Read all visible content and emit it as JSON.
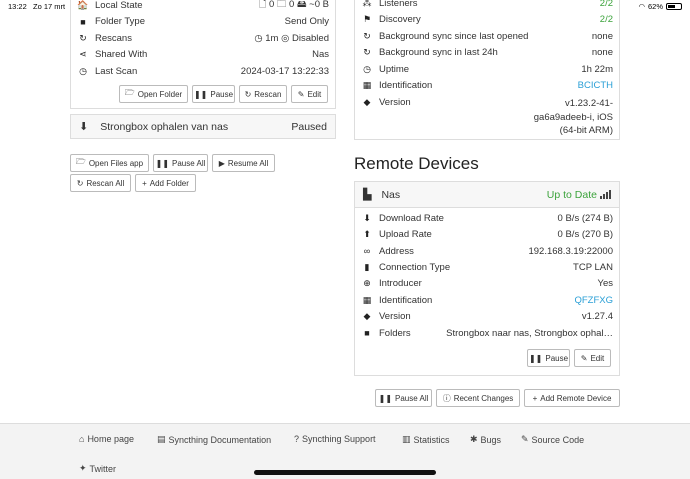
{
  "statusbar": {
    "time": "13:22",
    "date": "Zo 17 mrt",
    "battery": "62%",
    "battery_level": 0.62
  },
  "folder": {
    "rows": [
      {
        "icon": "globe-icon",
        "glyph": "🏠",
        "label": "Local State",
        "value": "🗋 0   🗀 0   🖴 ~0 B"
      },
      {
        "icon": "folder-icon",
        "glyph": "■",
        "label": "Folder Type",
        "value": "Send Only"
      },
      {
        "icon": "refresh-icon",
        "glyph": "↻",
        "label": "Rescans",
        "value": "◷ 1m   ◎ Disabled"
      },
      {
        "icon": "share-icon",
        "glyph": "⋖",
        "label": "Shared With",
        "value": "Nas"
      },
      {
        "icon": "clock-icon",
        "glyph": "◷",
        "label": "Last Scan",
        "value": "2024-03-17 13:22:33"
      }
    ],
    "buttons": {
      "open_folder": "Open Folder",
      "pause": "Pause",
      "rescan": "Rescan",
      "edit": "Edit"
    }
  },
  "strongbox": {
    "name": "Strongbox ophalen van nas",
    "status": "Paused"
  },
  "global_buttons": {
    "open_files": "Open Files app",
    "pause_all": "Pause All",
    "resume_all": "Resume All",
    "rescan_all": "Rescan All",
    "add_folder": "Add Folder"
  },
  "this_device": {
    "rows": [
      {
        "icon": "listeners-icon",
        "glyph": "⁂",
        "label": "Listeners",
        "value": "2/2",
        "color": "green"
      },
      {
        "icon": "discovery-icon",
        "glyph": "⚑",
        "label": "Discovery",
        "value": "2/2",
        "color": "green"
      },
      {
        "icon": "sync-icon",
        "glyph": "↻",
        "label": "Background sync since last opened",
        "value": "none",
        "color": ""
      },
      {
        "icon": "sync-icon",
        "glyph": "↻",
        "label": "Background sync in last 24h",
        "value": "none",
        "color": ""
      },
      {
        "icon": "clock-icon",
        "glyph": "◷",
        "label": "Uptime",
        "value": "1h 22m",
        "color": ""
      },
      {
        "icon": "qrcode-icon",
        "glyph": "▦",
        "label": "Identification",
        "value": "BCICTH",
        "color": "blue"
      }
    ],
    "version_label": "Version",
    "version_lines": [
      "v1.23.2-41-",
      "ga6a9adeeb-i, iOS",
      "(64-bit ARM)"
    ]
  },
  "remote_devices": {
    "title": "Remote Devices",
    "device_name": "Nas",
    "device_status": "Up to Date",
    "rows": [
      {
        "icon": "download-icon",
        "glyph": "⬇",
        "label": "Download Rate",
        "value": "0 B/s (274 B)",
        "color": ""
      },
      {
        "icon": "upload-icon",
        "glyph": "⬆",
        "label": "Upload Rate",
        "value": "0 B/s (270 B)",
        "color": ""
      },
      {
        "icon": "link-icon",
        "glyph": "∞",
        "label": "Address",
        "value": "192.168.3.19:22000",
        "color": ""
      },
      {
        "icon": "signal-icon",
        "glyph": "▮",
        "label": "Connection Type",
        "value": "TCP LAN",
        "color": ""
      },
      {
        "icon": "introducer-icon",
        "glyph": "⊕",
        "label": "Introducer",
        "value": "Yes",
        "color": ""
      },
      {
        "icon": "qrcode-icon",
        "glyph": "▦",
        "label": "Identification",
        "value": "QFZFXG",
        "color": "blue"
      },
      {
        "icon": "tag-icon",
        "glyph": "◆",
        "label": "Version",
        "value": "v1.27.4",
        "color": ""
      },
      {
        "icon": "folder-icon",
        "glyph": "■",
        "label": "Folders",
        "value": "Strongbox naar nas, Strongbox ophal…",
        "color": ""
      }
    ],
    "buttons": {
      "pause": "Pause",
      "edit": "Edit"
    }
  },
  "remote_global_buttons": {
    "pause_all": "Pause All",
    "recent_changes": "Recent Changes",
    "add_remote": "Add Remote Device"
  },
  "footer": {
    "links": [
      "Home page",
      "Syncthing Documentation",
      "Syncthing Support",
      "Statistics",
      "Bugs",
      "Source Code",
      "Twitter"
    ]
  }
}
